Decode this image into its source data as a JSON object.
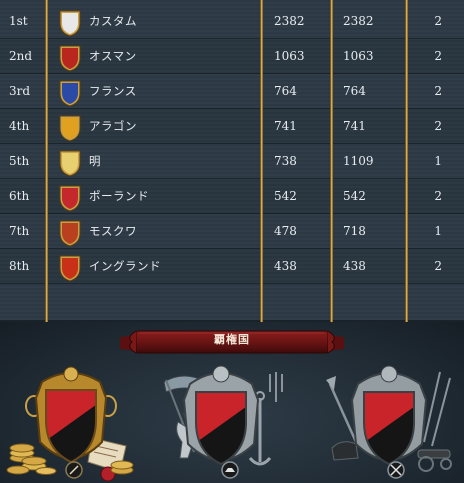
{
  "ranking": {
    "rows": [
      {
        "rank": "1st",
        "name": "カスタム",
        "v1": "2382",
        "v2": "2382",
        "v3": "2",
        "shield": "custom-white-shield-icon",
        "color": "#e8e8e8"
      },
      {
        "rank": "2nd",
        "name": "オスマン",
        "v1": "1063",
        "v2": "1063",
        "v3": "2",
        "shield": "ottoman-crescent-shield-icon",
        "color": "#b8261e"
      },
      {
        "rank": "3rd",
        "name": "フランス",
        "v1": "764",
        "v2": "764",
        "v3": "2",
        "shield": "france-fleur-de-lis-shield-icon",
        "color": "#2b4aa8"
      },
      {
        "rank": "4th",
        "name": "アラゴン",
        "v1": "741",
        "v2": "741",
        "v3": "2",
        "shield": "aragon-stripes-shield-icon",
        "color": "#e0a020"
      },
      {
        "rank": "5th",
        "name": "明",
        "v1": "738",
        "v2": "1109",
        "v3": "1",
        "shield": "ming-character-shield-icon",
        "color": "#e8d070"
      },
      {
        "rank": "6th",
        "name": "ポーランド",
        "v1": "542",
        "v2": "542",
        "v3": "2",
        "shield": "poland-eagle-shield-icon",
        "color": "#c4282c"
      },
      {
        "rank": "7th",
        "name": "モスクワ",
        "v1": "478",
        "v2": "718",
        "v3": "1",
        "shield": "muscovy-rider-shield-icon",
        "color": "#b8401e"
      },
      {
        "rank": "8th",
        "name": "イングランド",
        "v1": "438",
        "v2": "438",
        "v3": "2",
        "shield": "england-lions-shield-icon",
        "color": "#c83018"
      }
    ]
  },
  "hegemony": {
    "title": "覇権国",
    "emblems": [
      {
        "name": "economic-hegemon-emblem",
        "icon": "coins-and-scroll-icon"
      },
      {
        "name": "naval-hegemon-emblem",
        "icon": "anchor-and-trident-icon"
      },
      {
        "name": "military-hegemon-emblem",
        "icon": "cannon-and-weapons-icon"
      }
    ],
    "shield_colors": {
      "top": "#c8242a",
      "bottom": "#151515"
    }
  }
}
